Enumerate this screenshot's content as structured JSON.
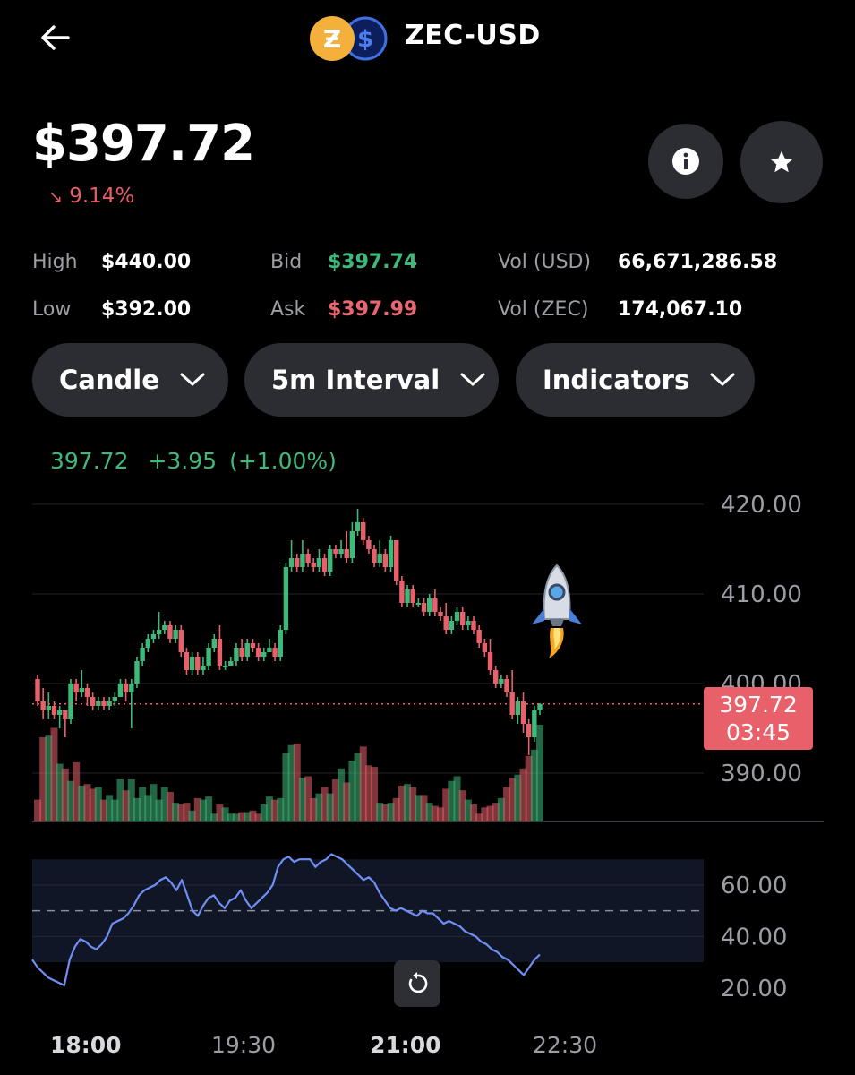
{
  "header": {
    "pair": "ZEC-USD",
    "base_coin_icon": "zcash-coin-icon",
    "quote_coin_icon": "usd-coin-icon"
  },
  "summary": {
    "price": "$397.72",
    "change": "9.14%",
    "change_direction": "down"
  },
  "stats": {
    "high_label": "High",
    "high_value": "$440.00",
    "low_label": "Low",
    "low_value": "$392.00",
    "bid_label": "Bid",
    "bid_value": "$397.74",
    "ask_label": "Ask",
    "ask_value": "$397.99",
    "vol_usd_label": "Vol (USD)",
    "vol_usd_value": "66,671,286.58",
    "vol_zec_label": "Vol (ZEC)",
    "vol_zec_value": "174,067.10"
  },
  "controls": {
    "chart_type": "Candle",
    "interval": "5m Interval",
    "indicators": "Indicators"
  },
  "ohlc_readout": {
    "last": "397.72",
    "change": "+3.95",
    "change_pct": "(+1.00%)"
  },
  "price_badge": {
    "price": "397.72",
    "countdown": "03:45"
  },
  "colors": {
    "up": "#3fb97a",
    "down": "#e8606a",
    "rsi_line": "#6f8ff5",
    "background": "#000000",
    "button_bg": "#2b2d32"
  },
  "chart_data": {
    "type": "candlestick",
    "y_ticks": [
      "420.00",
      "410.00",
      "400.00",
      "390.00"
    ],
    "y_tick_values": [
      420,
      410,
      400,
      390
    ],
    "ylim": [
      384.5,
      422
    ],
    "last_price": 397.72,
    "x_ticks": [
      "18:00",
      "19:30",
      "21:00",
      "22:30"
    ],
    "candles": [
      [
        400.5,
        398.0,
        401.0,
        397.5
      ],
      [
        398.0,
        397.0,
        399.5,
        396.0
      ],
      [
        397.0,
        397.5,
        399.0,
        396.0
      ],
      [
        397.5,
        396.5,
        398.0,
        396.0
      ],
      [
        396.5,
        397.0,
        397.5,
        395.0
      ],
      [
        397.0,
        396.0,
        397.0,
        394.0
      ],
      [
        396.0,
        400.0,
        400.5,
        395.5
      ],
      [
        400.0,
        399.0,
        400.5,
        398.0
      ],
      [
        399.0,
        399.5,
        401.5,
        398.5
      ],
      [
        399.5,
        398.5,
        400.0,
        397.5
      ],
      [
        398.5,
        397.5,
        399.0,
        397.0
      ],
      [
        397.5,
        398.0,
        398.5,
        397.0
      ],
      [
        398.0,
        397.5,
        398.5,
        397.0
      ],
      [
        397.5,
        398.0,
        398.5,
        397.0
      ],
      [
        398.0,
        398.5,
        399.0,
        397.5
      ],
      [
        398.5,
        400.0,
        400.5,
        398.5
      ],
      [
        400.0,
        399.0,
        400.5,
        398.0
      ],
      [
        399.0,
        400.0,
        400.5,
        395.0
      ],
      [
        400.0,
        402.5,
        403.0,
        399.5
      ],
      [
        402.5,
        404.0,
        404.5,
        402.0
      ],
      [
        404.0,
        405.0,
        405.5,
        403.5
      ],
      [
        405.0,
        405.5,
        406.0,
        404.5
      ],
      [
        405.5,
        406.0,
        408.0,
        405.0
      ],
      [
        406.0,
        406.5,
        407.0,
        405.5
      ],
      [
        406.5,
        405.0,
        407.0,
        404.5
      ],
      [
        405.0,
        406.0,
        406.5,
        404.5
      ],
      [
        406.0,
        403.5,
        406.5,
        403.0
      ],
      [
        403.5,
        401.5,
        404.0,
        401.0
      ],
      [
        401.5,
        403.0,
        403.5,
        401.0
      ],
      [
        403.0,
        401.5,
        403.5,
        401.0
      ],
      [
        401.5,
        402.0,
        403.0,
        401.0
      ],
      [
        402.0,
        404.0,
        404.5,
        401.5
      ],
      [
        404.0,
        405.0,
        405.5,
        403.5
      ],
      [
        405.0,
        402.0,
        406.5,
        401.5
      ],
      [
        402.0,
        402.0,
        402.5,
        401.5
      ],
      [
        402.0,
        402.5,
        403.0,
        402.0
      ],
      [
        402.5,
        404.0,
        404.5,
        402.0
      ],
      [
        404.0,
        403.0,
        405.0,
        402.5
      ],
      [
        403.0,
        404.5,
        405.0,
        402.5
      ],
      [
        404.5,
        404.0,
        405.0,
        403.5
      ],
      [
        404.0,
        403.0,
        404.5,
        402.5
      ],
      [
        403.0,
        403.5,
        404.0,
        402.5
      ],
      [
        403.5,
        404.0,
        405.0,
        403.5
      ],
      [
        404.0,
        403.0,
        404.5,
        402.5
      ],
      [
        403.0,
        406.0,
        406.5,
        402.5
      ],
      [
        406.0,
        413.0,
        413.5,
        405.5
      ],
      [
        413.0,
        414.0,
        416.0,
        412.5
      ],
      [
        414.0,
        413.0,
        414.5,
        412.5
      ],
      [
        413.0,
        414.5,
        416.0,
        412.5
      ],
      [
        414.5,
        413.5,
        415.0,
        413.0
      ],
      [
        413.5,
        413.0,
        414.0,
        412.5
      ],
      [
        413.0,
        414.0,
        415.0,
        412.5
      ],
      [
        414.0,
        412.5,
        414.5,
        412.0
      ],
      [
        412.5,
        415.0,
        415.5,
        412.0
      ],
      [
        415.0,
        414.5,
        415.5,
        414.0
      ],
      [
        414.5,
        415.0,
        416.0,
        414.0
      ],
      [
        415.0,
        414.0,
        417.0,
        413.5
      ],
      [
        414.0,
        417.0,
        418.0,
        413.5
      ],
      [
        417.0,
        418.0,
        419.5,
        416.5
      ],
      [
        418.0,
        416.0,
        418.5,
        415.5
      ],
      [
        416.0,
        415.0,
        416.5,
        414.5
      ],
      [
        415.0,
        413.5,
        415.5,
        413.0
      ],
      [
        413.5,
        414.5,
        416.0,
        413.0
      ],
      [
        414.5,
        413.0,
        415.0,
        412.5
      ],
      [
        413.0,
        416.0,
        416.5,
        412.5
      ],
      [
        416.0,
        411.5,
        416.0,
        411.0
      ],
      [
        411.5,
        409.0,
        412.0,
        408.5
      ],
      [
        409.0,
        410.5,
        411.0,
        408.5
      ],
      [
        410.5,
        409.0,
        411.0,
        408.5
      ],
      [
        409.0,
        409.0,
        409.5,
        408.5
      ],
      [
        409.0,
        408.0,
        409.5,
        407.5
      ],
      [
        408.0,
        409.5,
        410.0,
        407.5
      ],
      [
        409.5,
        408.0,
        410.5,
        407.5
      ],
      [
        408.0,
        407.5,
        408.5,
        407.0
      ],
      [
        407.5,
        406.0,
        409.0,
        405.5
      ],
      [
        406.0,
        407.0,
        407.5,
        405.5
      ],
      [
        407.0,
        408.0,
        408.5,
        406.5
      ],
      [
        408.0,
        406.5,
        408.5,
        406.0
      ],
      [
        406.5,
        407.0,
        407.5,
        406.0
      ],
      [
        407.0,
        406.0,
        407.5,
        405.5
      ],
      [
        406.0,
        404.5,
        406.5,
        404.0
      ],
      [
        404.5,
        403.5,
        405.0,
        403.0
      ],
      [
        403.5,
        401.5,
        405.0,
        401.0
      ],
      [
        401.5,
        400.0,
        402.0,
        399.5
      ],
      [
        400.0,
        400.5,
        401.0,
        399.5
      ],
      [
        400.5,
        399.0,
        401.0,
        398.5
      ],
      [
        399.0,
        396.5,
        401.5,
        396.0
      ],
      [
        396.5,
        398.0,
        398.5,
        395.5
      ],
      [
        398.0,
        395.5,
        399.0,
        394.5
      ],
      [
        395.5,
        394.0,
        396.0,
        392.0
      ],
      [
        394.0,
        397.0,
        397.5,
        393.5
      ],
      [
        397.0,
        397.72,
        397.8,
        396.5
      ]
    ],
    "volume": [
      14,
      54,
      55,
      60,
      37,
      34,
      26,
      38,
      23,
      24,
      21,
      22,
      14,
      17,
      14,
      27,
      20,
      27,
      15,
      22,
      17,
      24,
      14,
      22,
      19,
      12,
      11,
      12,
      7,
      15,
      14,
      16,
      5,
      11,
      9,
      5,
      5,
      6,
      6,
      7,
      5,
      11,
      16,
      14,
      15,
      44,
      49,
      50,
      28,
      29,
      15,
      18,
      22,
      18,
      27,
      34,
      25,
      39,
      44,
      48,
      36,
      35,
      12,
      11,
      12,
      15,
      23,
      24,
      22,
      17,
      17,
      12,
      10,
      9,
      21,
      26,
      29,
      20,
      14,
      11,
      5,
      9,
      10,
      12,
      15,
      22,
      28,
      30,
      34,
      42,
      46,
      62,
      50,
      14
    ],
    "volume_max": 62,
    "rsi": {
      "ylim": [
        14,
        76
      ],
      "y_ticks": [
        "60.00",
        "40.00",
        "20.00"
      ],
      "y_tick_values": [
        60,
        40,
        20
      ],
      "midline": 50,
      "band": [
        30,
        70
      ],
      "values": [
        31,
        28,
        26,
        24,
        23,
        22,
        21,
        31,
        36,
        39,
        38,
        36,
        35,
        37,
        40,
        45,
        46,
        47,
        49,
        52,
        56,
        58,
        59,
        60,
        62,
        63,
        61,
        58,
        62,
        56,
        50,
        48,
        52,
        55,
        56,
        53,
        51,
        54,
        55,
        58,
        54,
        51,
        53,
        55,
        57,
        60,
        67,
        70,
        71,
        69,
        70,
        70,
        70,
        67,
        69,
        70,
        72,
        71,
        70,
        68,
        66,
        64,
        62,
        63,
        61,
        57,
        54,
        51,
        50,
        51,
        50,
        49,
        48,
        50,
        49,
        49,
        47,
        45,
        46,
        45,
        44,
        42,
        41,
        40,
        38,
        37,
        35,
        34,
        32,
        31,
        29,
        27,
        25,
        28,
        31,
        33
      ]
    }
  }
}
